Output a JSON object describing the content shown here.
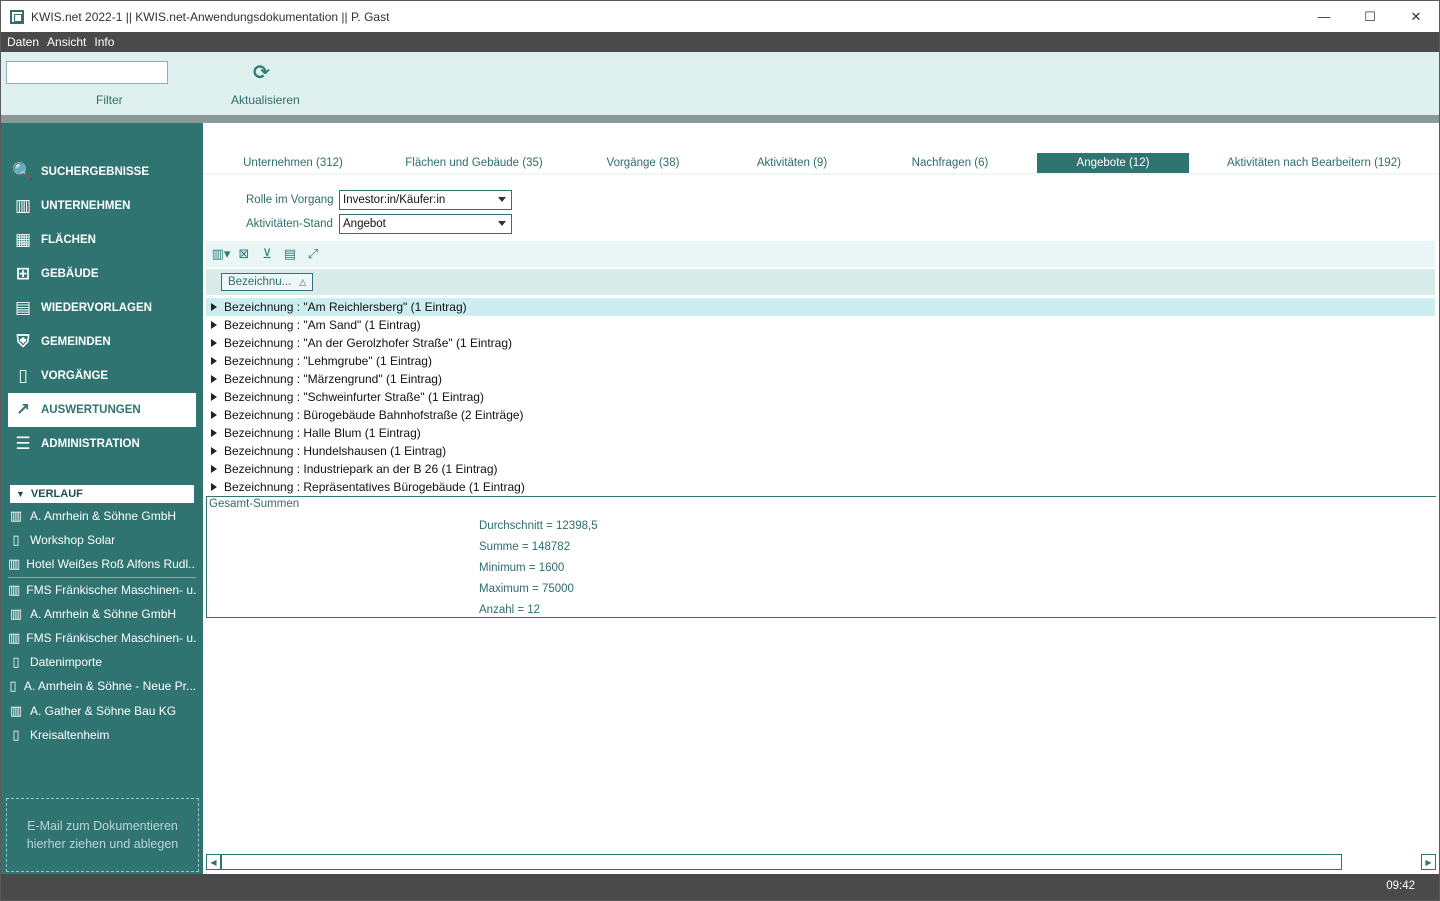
{
  "window": {
    "title": "KWIS.net 2022-1 || KWIS.net-Anwendungsdokumentation || P. Gast",
    "minimize": "—",
    "maximize": "☐",
    "close": "✕"
  },
  "menu": [
    "Daten",
    "Ansicht",
    "Info"
  ],
  "toolbar": {
    "filter_value": "",
    "filter_label": "Filter",
    "refresh_label": "Aktualisieren",
    "refresh_icon": "refresh-icon"
  },
  "nav": [
    {
      "label": "SUCHERGEBNISSE",
      "icon": "🔍",
      "active": false
    },
    {
      "label": "UNTERNEHMEN",
      "icon": "▥",
      "active": false
    },
    {
      "label": "FLÄCHEN",
      "icon": "▦",
      "active": false
    },
    {
      "label": "GEBÄUDE",
      "icon": "⊞",
      "active": false
    },
    {
      "label": "WIEDERVORLAGEN",
      "icon": "▤",
      "active": false
    },
    {
      "label": "GEMEINDEN",
      "icon": "⛨",
      "active": false
    },
    {
      "label": "VORGÄNGE",
      "icon": "▯",
      "active": false
    },
    {
      "label": "AUSWERTUNGEN",
      "icon": "↗",
      "active": true
    },
    {
      "label": "ADMINISTRATION",
      "icon": "☰",
      "active": false
    }
  ],
  "verlauf": {
    "title": "VERLAUF",
    "items": [
      {
        "label": "A. Amrhein & Söhne GmbH",
        "icon": "▥"
      },
      {
        "label": "Workshop Solar",
        "icon": "▯"
      },
      {
        "label": "Hotel Weißes Roß Alfons Rudl...",
        "icon": "▥"
      },
      {
        "label": "FMS Fränkischer Maschinen- u...",
        "icon": "▥"
      },
      {
        "label": "A. Amrhein & Söhne GmbH",
        "icon": "▥"
      },
      {
        "label": "FMS Fränkischer Maschinen- u...",
        "icon": "▥"
      },
      {
        "label": "Datenimporte",
        "icon": "▯"
      },
      {
        "label": "A. Amrhein & Söhne - Neue Pr...",
        "icon": "▯"
      },
      {
        "label": "A. Gather & Söhne Bau KG",
        "icon": "▥"
      },
      {
        "label": "Kreisaltenheim",
        "icon": "▯"
      }
    ],
    "dropzone": "E-Mail  zum Dokumentieren hierher ziehen und ablegen"
  },
  "tabs": [
    {
      "label": "Unternehmen (312)",
      "active": false
    },
    {
      "label": "Flächen und Gebäude (35)",
      "active": false
    },
    {
      "label": "Vorgänge (38)",
      "active": false
    },
    {
      "label": "Aktivitäten (9)",
      "active": false
    },
    {
      "label": "Nachfragen (6)",
      "active": false
    },
    {
      "label": "Angebote (12)",
      "active": true
    },
    {
      "label": "Aktivitäten nach Bearbeitern (192)",
      "active": false
    }
  ],
  "filters": {
    "rolle_label": "Rolle im Vorgang",
    "rolle_value": "Investor:in/Käufer:in",
    "stand_label": "Aktivitäten-Stand",
    "stand_value": "Angebot"
  },
  "grid": {
    "group_chip": "Bezeichnu...",
    "rows": [
      "Bezeichnung : \"Am Reichlersberg\" (1 Eintrag)",
      "Bezeichnung : \"Am Sand\" (1 Eintrag)",
      "Bezeichnung : \"An der Gerolzhofer Straße\" (1 Eintrag)",
      "Bezeichnung : \"Lehmgrube\" (1 Eintrag)",
      "Bezeichnung : \"Märzengrund\" (1 Eintrag)",
      "Bezeichnung : \"Schweinfurter Straße\" (1 Eintrag)",
      "Bezeichnung : Bürogebäude Bahnhofstraße (2 Einträge)",
      "Bezeichnung : Halle Blum (1 Eintrag)",
      "Bezeichnung : Hundelshausen (1 Eintrag)",
      "Bezeichnung : Industriepark an der B 26 (1 Eintrag)",
      "Bezeichnung : Repräsentatives Bürogebäude (1 Eintrag)"
    ],
    "selected_row": 0
  },
  "summary": {
    "title": "Gesamt-Summen",
    "lines": [
      "Durchschnitt = 12398,5",
      "Summe = 148782",
      "Minimum = 1600",
      "Maximum = 75000",
      "Anzahl = 12"
    ]
  },
  "status": {
    "clock": "09:42"
  },
  "colors": {
    "accent": "#2f7471",
    "toolbar_bg": "#dff1ef",
    "menubar": "#4a4a4a"
  }
}
